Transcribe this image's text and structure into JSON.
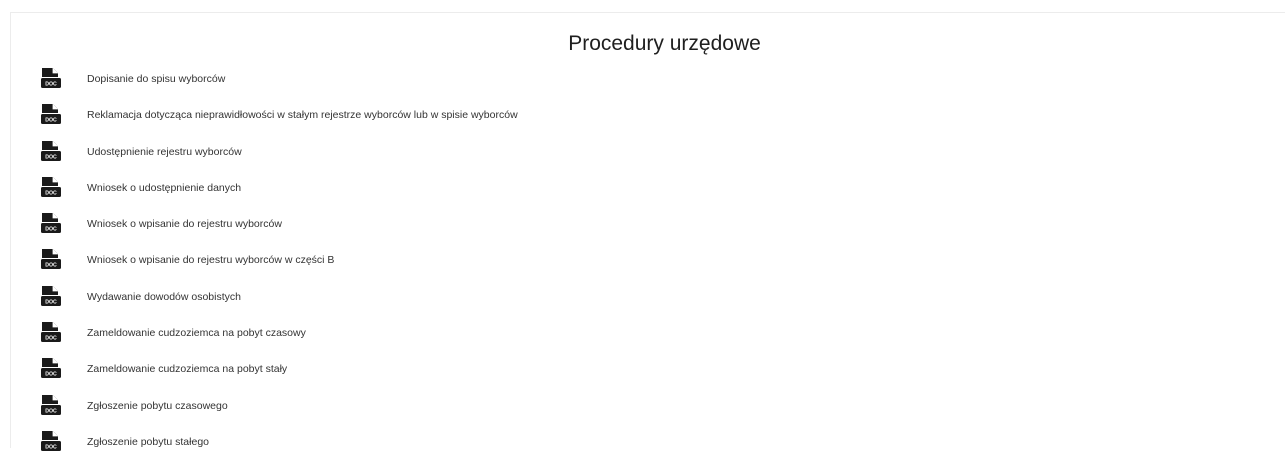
{
  "page": {
    "title": "Procedury urzędowe"
  },
  "icon": {
    "name": "doc-file-icon",
    "badge_text": "DOC",
    "color": "#1a1a1a"
  },
  "documents": [
    {
      "label": "Dopisanie do spisu wyborców"
    },
    {
      "label": "Reklamacja dotycząca nieprawidłowości w stałym rejestrze wyborców lub w spisie wyborców"
    },
    {
      "label": "Udostępnienie rejestru wyborców"
    },
    {
      "label": "Wniosek o udostępnienie danych"
    },
    {
      "label": "Wniosek o wpisanie do rejestru wyborców"
    },
    {
      "label": "Wniosek o wpisanie do rejestru wyborców w części B"
    },
    {
      "label": "Wydawanie dowodów osobistych"
    },
    {
      "label": "Zameldowanie cudzoziemca na pobyt czasowy"
    },
    {
      "label": "Zameldowanie cudzoziemca na pobyt stały"
    },
    {
      "label": "Zgłoszenie pobytu czasowego"
    },
    {
      "label": "Zgłoszenie pobytu stałego"
    }
  ]
}
